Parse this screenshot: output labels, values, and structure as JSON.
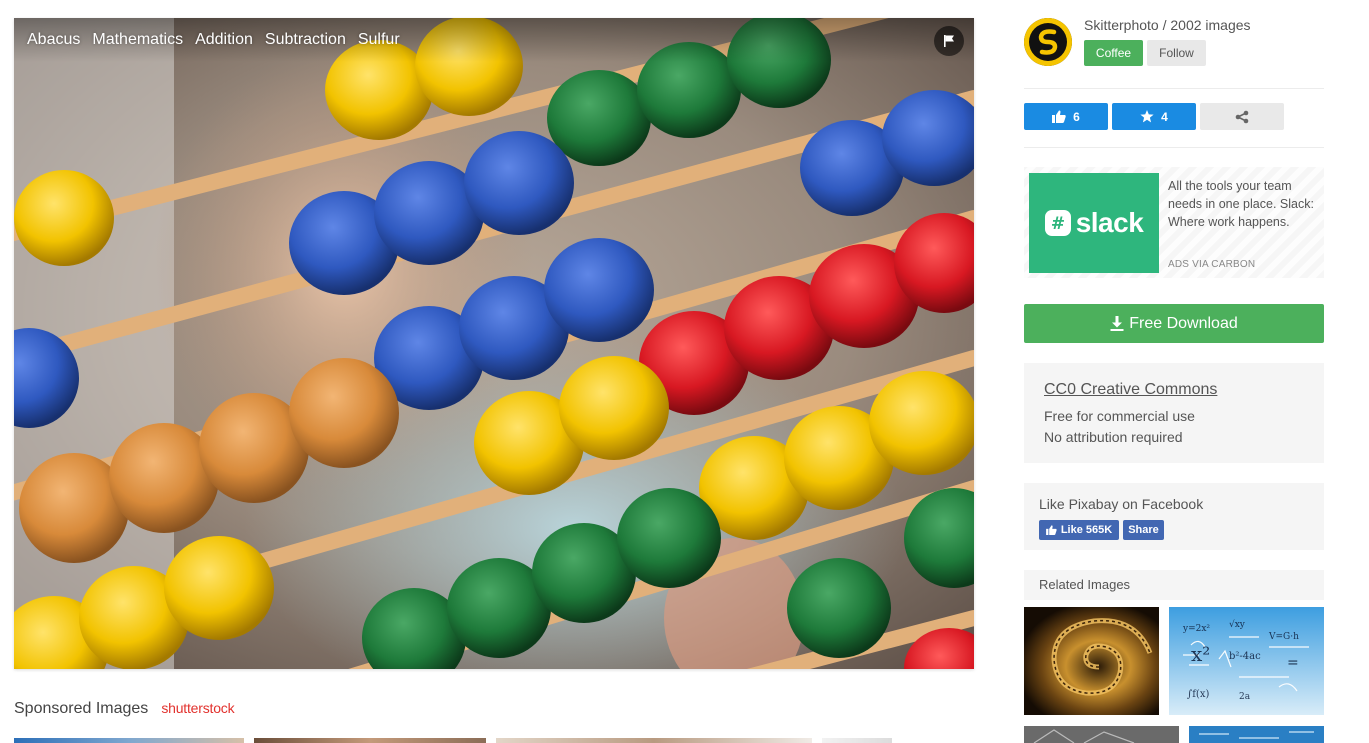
{
  "photo": {
    "tags": [
      "Abacus",
      "Mathematics",
      "Addition",
      "Subtraction",
      "Sulfur"
    ],
    "flag_icon": "flag-icon",
    "bead_colors": {
      "yellow": "#f2c300",
      "blue": "#2f59c0",
      "green": "#1e7a3a",
      "red": "#d81822",
      "orange": "#d88a3a"
    }
  },
  "sponsored": {
    "title": "Sponsored Images",
    "provider": "shutterstock"
  },
  "author": {
    "name_line": "Skitterphoto / 2002 images",
    "coffee_label": "Coffee",
    "follow_label": "Follow",
    "avatar_icon": "skitterphoto-logo-icon"
  },
  "actions": {
    "likes": "6",
    "favorites": "4",
    "like_icon": "thumbs-up-icon",
    "favorite_icon": "star-icon",
    "share_icon": "share-icon"
  },
  "ad": {
    "brand": "slack",
    "text": "All the tools your team needs in one place. Slack: Where work happens.",
    "via": "ADS VIA CARBON"
  },
  "download": {
    "label": "Free Download",
    "icon": "download-icon"
  },
  "license": {
    "title": "CC0 Creative Commons",
    "line1": "Free for commercial use",
    "line2": "No attribution required"
  },
  "facebook": {
    "title": "Like Pixabay on Facebook",
    "like_label": "Like 565K",
    "share_label": "Share"
  },
  "related": {
    "title": "Related Images"
  },
  "colors": {
    "green_button": "#4cb05c",
    "blue_button": "#1a8be2",
    "facebook_blue": "#4267b2",
    "shutterstock_red": "#e2322e",
    "slack_green": "#2eb67d"
  }
}
